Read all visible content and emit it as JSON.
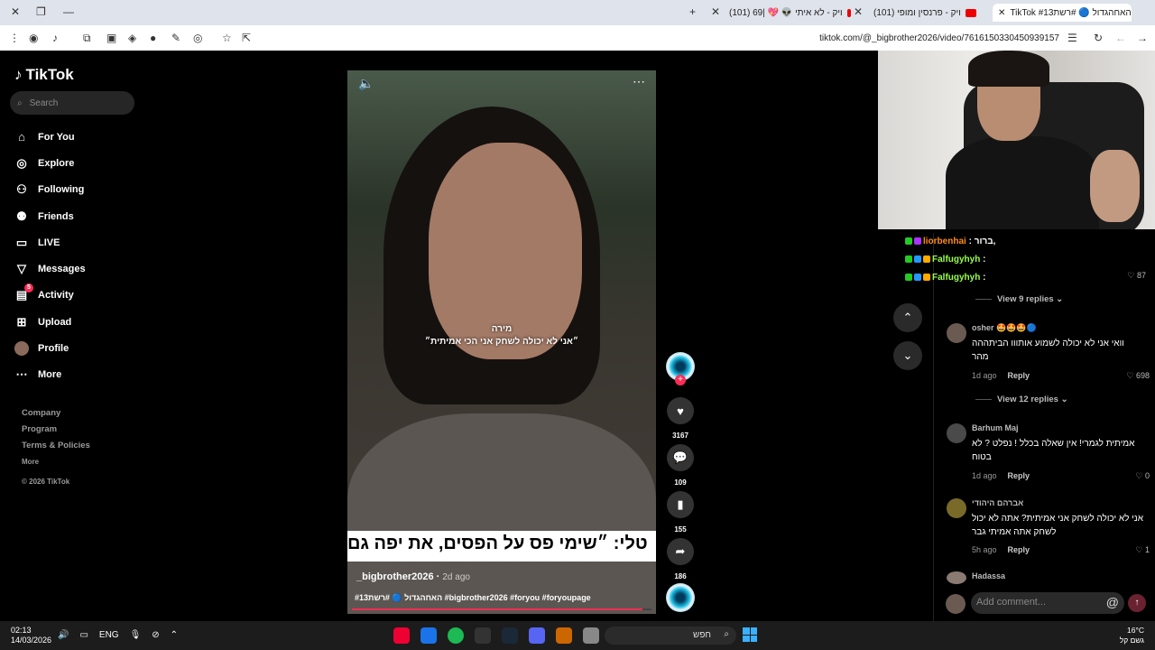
{
  "browser": {
    "tabs": [
      {
        "label": "(101) ויק - פרנסין ומופי"
      },
      {
        "label": "(101) ויק - לא איתי 👽 💖 |69"
      },
      {
        "label": "TikTok #האחהגדול 🔵 #רשת13"
      }
    ],
    "url": "tiktok.com/@_bigbrother2026/video/7616150330450939157"
  },
  "sidebar": {
    "logo": "TikTok",
    "search_placeholder": "Search",
    "items": [
      {
        "label": "For You",
        "icon": "home-icon"
      },
      {
        "label": "Explore",
        "icon": "compass-icon"
      },
      {
        "label": "Following",
        "icon": "following-icon"
      },
      {
        "label": "Friends",
        "icon": "friends-icon"
      },
      {
        "label": "LIVE",
        "icon": "live-icon"
      },
      {
        "label": "Messages",
        "icon": "messages-icon"
      },
      {
        "label": "Activity",
        "icon": "activity-icon",
        "badge": "5"
      },
      {
        "label": "Upload",
        "icon": "upload-icon"
      },
      {
        "label": "Profile",
        "icon": "profile-icon"
      },
      {
        "label": "More",
        "icon": "more-icon"
      }
    ],
    "footer": [
      "Company",
      "Program",
      "Terms & Policies",
      "More",
      "© 2026 TikTok"
    ]
  },
  "video": {
    "caption_name": "מירה",
    "caption_quote": "״אני לא יכולה לשחק אני הכי אמיתית״",
    "banner": "טלי: ״שימי פס על הפסים, את יפה גם",
    "author": "_bigbrother2026",
    "posted": "2d ago",
    "tags": "#האחהגדול 🔵 #רשת13 #bigbrother2026 #foryou #foryoupage",
    "progress": 0.97
  },
  "actions": {
    "likes": "3167",
    "comments": "109",
    "saves": "155",
    "shares": "186"
  },
  "chat": [
    {
      "user": "liorbenhai",
      "text": ": ברור,"
    },
    {
      "user": "Falfugyhyh",
      "text": ": "
    },
    {
      "user": "Falfugyhyh",
      "text": ": "
    }
  ],
  "comments": {
    "top_like": "87",
    "view_replies_1": "View 9 replies",
    "items": [
      {
        "user": "osher",
        "text": "וואי אני לא יכולה לשמוע אותווו הביתההה מהר",
        "time": "1d ago",
        "reply": "Reply",
        "likes": "698"
      },
      {
        "user": "Barhum Maj",
        "text": "אמיתית לגמרי! אין שאלה בכלל ! נפלט ? לא בטוח",
        "time": "1d ago",
        "reply": "Reply",
        "likes": "0"
      },
      {
        "user": "אברהם היהודי",
        "text": "אני לא יכולה לשחק אני אמיתית? אתה לא יכול לשחק אתה אמיתי גבר",
        "time": "5h ago",
        "reply": "Reply",
        "likes": "1"
      },
      {
        "user": "Hadassa",
        "text": "",
        "time": "",
        "reply": "",
        "likes": ""
      }
    ],
    "view_replies_2": "View 12 replies",
    "add_placeholder": "Add comment..."
  },
  "taskbar": {
    "time": "02:13",
    "date": "14/03/2026",
    "lang": "ENG",
    "search": "חפש",
    "temp": "16°C",
    "weather": "גשם קל"
  }
}
